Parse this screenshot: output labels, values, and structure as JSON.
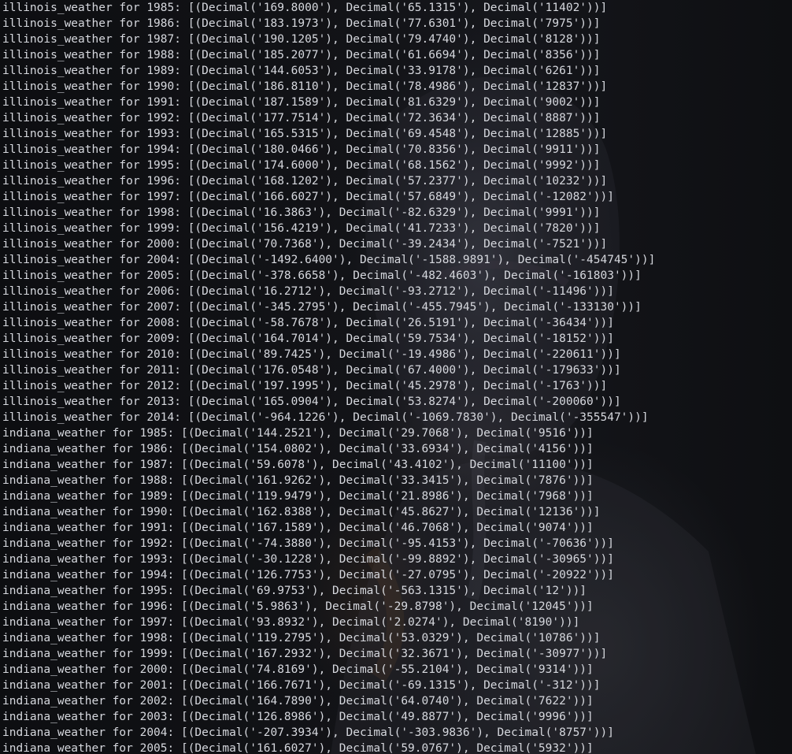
{
  "terminal": {
    "lines": [
      "illinois_weather for 1985: [(Decimal('169.8000'), Decimal('65.1315'), Decimal('11402'))]",
      "illinois_weather for 1986: [(Decimal('183.1973'), Decimal('77.6301'), Decimal('7975'))]",
      "illinois_weather for 1987: [(Decimal('190.1205'), Decimal('79.4740'), Decimal('8128'))]",
      "illinois_weather for 1988: [(Decimal('185.2077'), Decimal('61.6694'), Decimal('8356'))]",
      "illinois_weather for 1989: [(Decimal('144.6053'), Decimal('33.9178'), Decimal('6261'))]",
      "illinois_weather for 1990: [(Decimal('186.8110'), Decimal('78.4986'), Decimal('12837'))]",
      "illinois_weather for 1991: [(Decimal('187.1589'), Decimal('81.6329'), Decimal('9002'))]",
      "illinois_weather for 1992: [(Decimal('177.7514'), Decimal('72.3634'), Decimal('8887'))]",
      "illinois_weather for 1993: [(Decimal('165.5315'), Decimal('69.4548'), Decimal('12885'))]",
      "illinois_weather for 1994: [(Decimal('180.0466'), Decimal('70.8356'), Decimal('9911'))]",
      "illinois_weather for 1995: [(Decimal('174.6000'), Decimal('68.1562'), Decimal('9992'))]",
      "illinois_weather for 1996: [(Decimal('168.1202'), Decimal('57.2377'), Decimal('10232'))]",
      "illinois_weather for 1997: [(Decimal('166.6027'), Decimal('57.6849'), Decimal('-12082'))]",
      "illinois_weather for 1998: [(Decimal('16.3863'), Decimal('-82.6329'), Decimal('9991'))]",
      "illinois_weather for 1999: [(Decimal('156.4219'), Decimal('41.7233'), Decimal('7820'))]",
      "illinois_weather for 2000: [(Decimal('70.7368'), Decimal('-39.2434'), Decimal('-7521'))]",
      "illinois_weather for 2004: [(Decimal('-1492.6400'), Decimal('-1588.9891'), Decimal('-454745'))]",
      "illinois_weather for 2005: [(Decimal('-378.6658'), Decimal('-482.4603'), Decimal('-161803'))]",
      "illinois_weather for 2006: [(Decimal('16.2712'), Decimal('-93.2712'), Decimal('-11496'))]",
      "illinois_weather for 2007: [(Decimal('-345.2795'), Decimal('-455.7945'), Decimal('-133130'))]",
      "illinois_weather for 2008: [(Decimal('-58.7678'), Decimal('26.5191'), Decimal('-36434'))]",
      "illinois_weather for 2009: [(Decimal('164.7014'), Decimal('59.7534'), Decimal('-18152'))]",
      "illinois_weather for 2010: [(Decimal('89.7425'), Decimal('-19.4986'), Decimal('-220611'))]",
      "illinois_weather for 2011: [(Decimal('176.0548'), Decimal('67.4000'), Decimal('-179633'))]",
      "illinois_weather for 2012: [(Decimal('197.1995'), Decimal('45.2978'), Decimal('-1763'))]",
      "illinois_weather for 2013: [(Decimal('165.0904'), Decimal('53.8274'), Decimal('-200060'))]",
      "illinois_weather for 2014: [(Decimal('-964.1226'), Decimal('-1069.7830'), Decimal('-355547'))]",
      "indiana_weather for 1985: [(Decimal('144.2521'), Decimal('29.7068'), Decimal('9516'))]",
      "indiana_weather for 1986: [(Decimal('154.0802'), Decimal('33.6934'), Decimal('4156'))]",
      "indiana_weather for 1987: [(Decimal('59.6078'), Decimal('43.4102'), Decimal('11100'))]",
      "indiana_weather for 1988: [(Decimal('161.9262'), Decimal('33.3415'), Decimal('7876'))]",
      "indiana_weather for 1989: [(Decimal('119.9479'), Decimal('21.8986'), Decimal('7968'))]",
      "indiana_weather for 1990: [(Decimal('162.8388'), Decimal('45.8627'), Decimal('12136'))]",
      "indiana_weather for 1991: [(Decimal('167.1589'), Decimal('46.7068'), Decimal('9074'))]",
      "indiana_weather for 1992: [(Decimal('-74.3880'), Decimal('-95.4153'), Decimal('-70636'))]",
      "indiana_weather for 1993: [(Decimal('-30.1228'), Decimal('-99.8892'), Decimal('-30965'))]",
      "indiana_weather for 1994: [(Decimal('126.7753'), Decimal('-27.0795'), Decimal('-20922'))]",
      "indiana_weather for 1995: [(Decimal('69.9753'), Decimal('-563.1315'), Decimal('12'))]",
      "indiana_weather for 1996: [(Decimal('5.9863'), Decimal('-29.8798'), Decimal('12045'))]",
      "indiana_weather for 1997: [(Decimal('93.8932'), Decimal('2.0274'), Decimal('8190'))]",
      "indiana_weather for 1998: [(Decimal('119.2795'), Decimal('53.0329'), Decimal('10786'))]",
      "indiana_weather for 1999: [(Decimal('167.2932'), Decimal('32.3671'), Decimal('-30977'))]",
      "indiana_weather for 2000: [(Decimal('74.8169'), Decimal('-55.2104'), Decimal('9314'))]",
      "indiana_weather for 2001: [(Decimal('166.7671'), Decimal('-69.1315'), Decimal('-312'))]",
      "indiana_weather for 2002: [(Decimal('164.7890'), Decimal('64.0740'), Decimal('7622'))]",
      "indiana_weather for 2003: [(Decimal('126.8986'), Decimal('49.8877'), Decimal('9996'))]",
      "indiana_weather for 2004: [(Decimal('-207.3934'), Decimal('-303.9836'), Decimal('8757'))]",
      "indiana_weather for 2005: [(Decimal('161.6027'), Decimal('59.0767'), Decimal('5932'))]"
    ]
  },
  "colors": {
    "text": "#d6d8de",
    "background": "#0c0d10"
  }
}
